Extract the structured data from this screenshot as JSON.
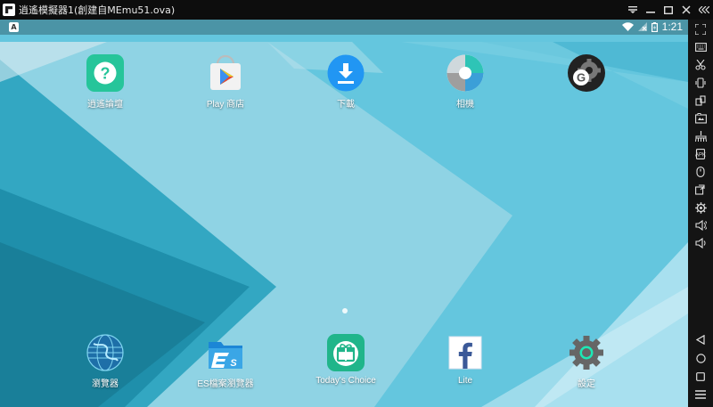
{
  "window": {
    "title": "逍遙模擬器1(創建自MEmu51.ova)",
    "controls": [
      "menu-icon",
      "minimize-icon",
      "maximize-icon",
      "close-icon",
      "collapse-icon"
    ]
  },
  "statusbar": {
    "time": "1:21"
  },
  "apps_top": [
    {
      "label": "逍遙論壇",
      "icon": "help-question-icon",
      "color": "#26c59a"
    },
    {
      "label": "Play 商店",
      "icon": "play-store-icon",
      "color": "#f2f2f2"
    },
    {
      "label": "下載",
      "icon": "download-icon",
      "color": "#2196f3"
    },
    {
      "label": "相機",
      "icon": "camera-icon",
      "color": "#ffffff"
    },
    {
      "label": "",
      "icon": "google-settings-icon",
      "color": "#333333"
    }
  ],
  "apps_bottom": [
    {
      "label": "瀏覽器",
      "icon": "browser-globe-icon",
      "color": "#1e6fa8"
    },
    {
      "label": "ES檔案瀏覽器",
      "icon": "es-file-explorer-icon",
      "color": "#3aa6e6"
    },
    {
      "label": "Today's Choice",
      "icon": "todays-choice-gift-icon",
      "color": "#20b58a"
    },
    {
      "label": "Lite",
      "icon": "facebook-lite-icon",
      "color": "#3b5998"
    },
    {
      "label": "設定",
      "icon": "settings-gear-icon",
      "color": "#666666"
    }
  ],
  "sidebar": {
    "tools": [
      "fullscreen-icon",
      "keyboard-icon",
      "scissors-icon",
      "shake-icon",
      "rotate-icon",
      "screenshot-icon",
      "broom-icon",
      "apk-install-icon",
      "record-icon",
      "share-icon",
      "gear-icon",
      "volume-up-icon",
      "volume-down-icon"
    ],
    "nav": [
      "back-icon",
      "home-icon",
      "recent-apps-icon",
      "more-icon"
    ]
  }
}
